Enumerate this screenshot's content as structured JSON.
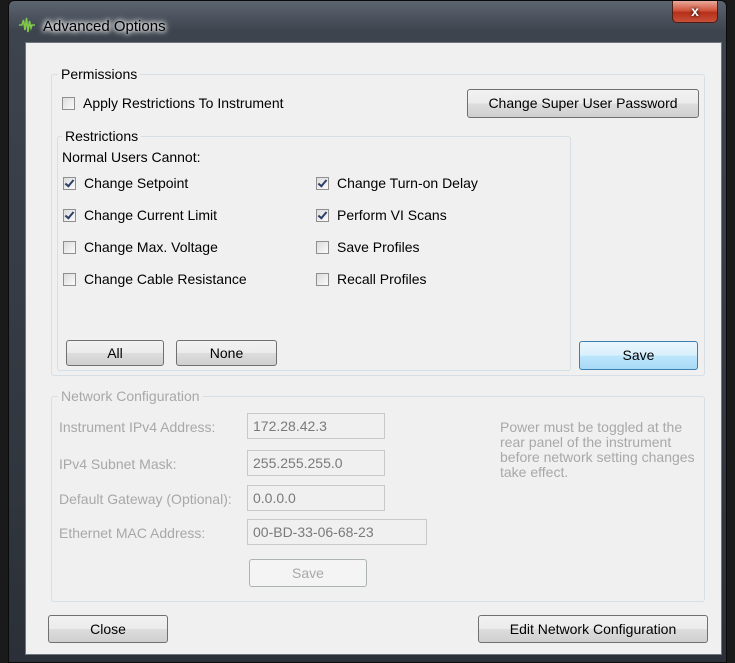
{
  "window": {
    "title": "Advanced Options",
    "close_glyph": "x",
    "app_icon": "waveform-icon"
  },
  "permissions": {
    "legend": "Permissions",
    "apply_restrictions": {
      "label": "Apply Restrictions To Instrument",
      "checked": false
    },
    "change_password_label": "Change Super User Password",
    "restrictions": {
      "legend": "Restrictions",
      "heading": "Normal Users Cannot:",
      "items": [
        {
          "label": "Change Setpoint",
          "checked": true
        },
        {
          "label": "Change Current Limit",
          "checked": true
        },
        {
          "label": "Change Max. Voltage",
          "checked": false
        },
        {
          "label": "Change Cable Resistance",
          "checked": false
        },
        {
          "label": "Change Turn-on Delay",
          "checked": true
        },
        {
          "label": "Perform VI Scans",
          "checked": true
        },
        {
          "label": "Save Profiles",
          "checked": false
        },
        {
          "label": "Recall Profiles",
          "checked": false
        }
      ],
      "all_label": "All",
      "none_label": "None"
    },
    "save_label": "Save"
  },
  "network": {
    "legend": "Network Configuration",
    "ipv4_label": "Instrument IPv4 Address:",
    "ipv4_value": "172.28.42.3",
    "subnet_label": "IPv4 Subnet Mask:",
    "subnet_value": "255.255.255.0",
    "gateway_label": "Default Gateway (Optional):",
    "gateway_value": "0.0.0.0",
    "mac_label": "Ethernet MAC Address:",
    "mac_value": "00-BD-33-06-68-23",
    "save_label": "Save",
    "note": "Power must be toggled at the rear panel of the instrument before network setting changes take effect."
  },
  "footer": {
    "close_label": "Close",
    "edit_network_label": "Edit Network Configuration"
  },
  "colors": {
    "focused_button": "#bee6fd",
    "close_button": "#c8503a",
    "disabled_text": "#a8a8a8"
  }
}
